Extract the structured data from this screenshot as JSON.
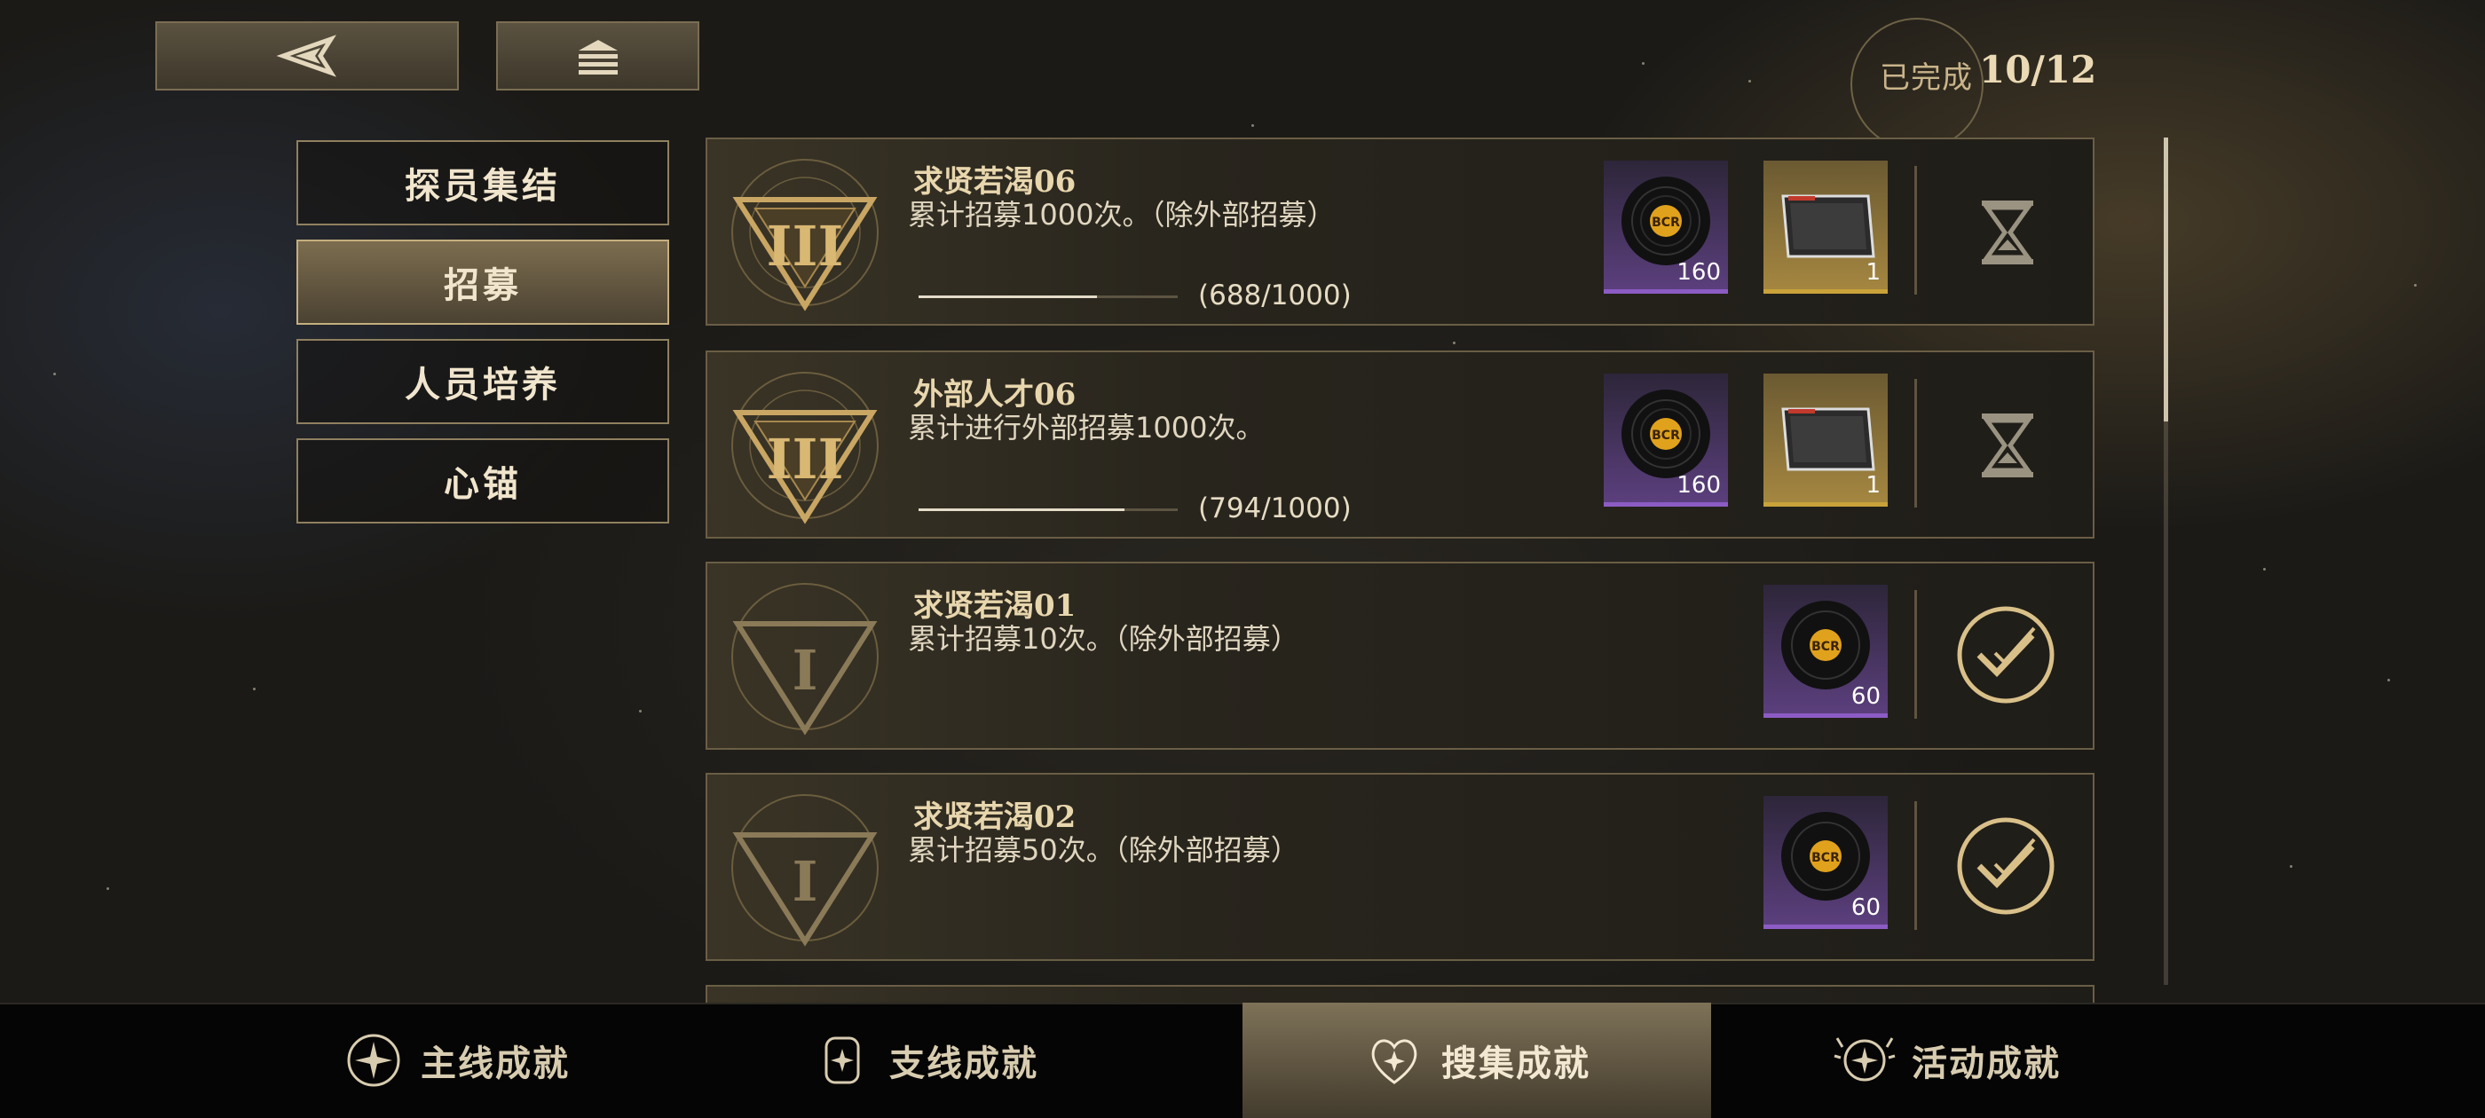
{
  "header": {
    "back_icon": "back-arrow-icon",
    "home_icon": "home-stack-icon",
    "completed_label": "已完成",
    "completed_count": "10/12"
  },
  "sidebar": {
    "items": [
      {
        "label": "探员集结",
        "active": false
      },
      {
        "label": "招募",
        "active": true
      },
      {
        "label": "人员培养",
        "active": false
      },
      {
        "label": "心锚",
        "active": false
      }
    ]
  },
  "tasks": [
    {
      "name": "求贤若渴06",
      "desc": "累计招募1000次。（除外部招募）",
      "emblem": "III",
      "progress_text": "(688/1000)",
      "progress": 0.688,
      "rewards": [
        {
          "icon": "record-disc-icon",
          "qty": "160",
          "rarity": "purple"
        },
        {
          "icon": "ticket-icon",
          "qty": "1",
          "rarity": "gold"
        }
      ],
      "state": "in-progress"
    },
    {
      "name": "外部人才06",
      "desc": "累计进行外部招募1000次。",
      "emblem": "III",
      "progress_text": "(794/1000)",
      "progress": 0.794,
      "rewards": [
        {
          "icon": "record-disc-icon",
          "qty": "160",
          "rarity": "purple"
        },
        {
          "icon": "ticket-icon",
          "qty": "1",
          "rarity": "gold"
        }
      ],
      "state": "in-progress"
    },
    {
      "name": "求贤若渴01",
      "desc": "累计招募10次。（除外部招募）",
      "emblem": "I",
      "rewards": [
        {
          "icon": "record-disc-icon",
          "qty": "60",
          "rarity": "purple"
        }
      ],
      "state": "completed"
    },
    {
      "name": "求贤若渴02",
      "desc": "累计招募50次。（除外部招募）",
      "emblem": "I",
      "rewards": [
        {
          "icon": "record-disc-icon",
          "qty": "60",
          "rarity": "purple"
        }
      ],
      "state": "completed"
    }
  ],
  "disc_label": "BCR",
  "bottom_tabs": [
    {
      "label": "主线成就",
      "icon": "main-achievement-icon",
      "active": false
    },
    {
      "label": "支线成就",
      "icon": "side-achievement-icon",
      "active": false
    },
    {
      "label": "搜集成就",
      "icon": "collection-achievement-icon",
      "active": true
    },
    {
      "label": "活动成就",
      "icon": "event-achievement-icon",
      "active": false
    }
  ],
  "colors": {
    "accent_gold": "#c5af80",
    "rarity_purple": "#8c5cc4",
    "rarity_gold": "#c9a23a"
  }
}
